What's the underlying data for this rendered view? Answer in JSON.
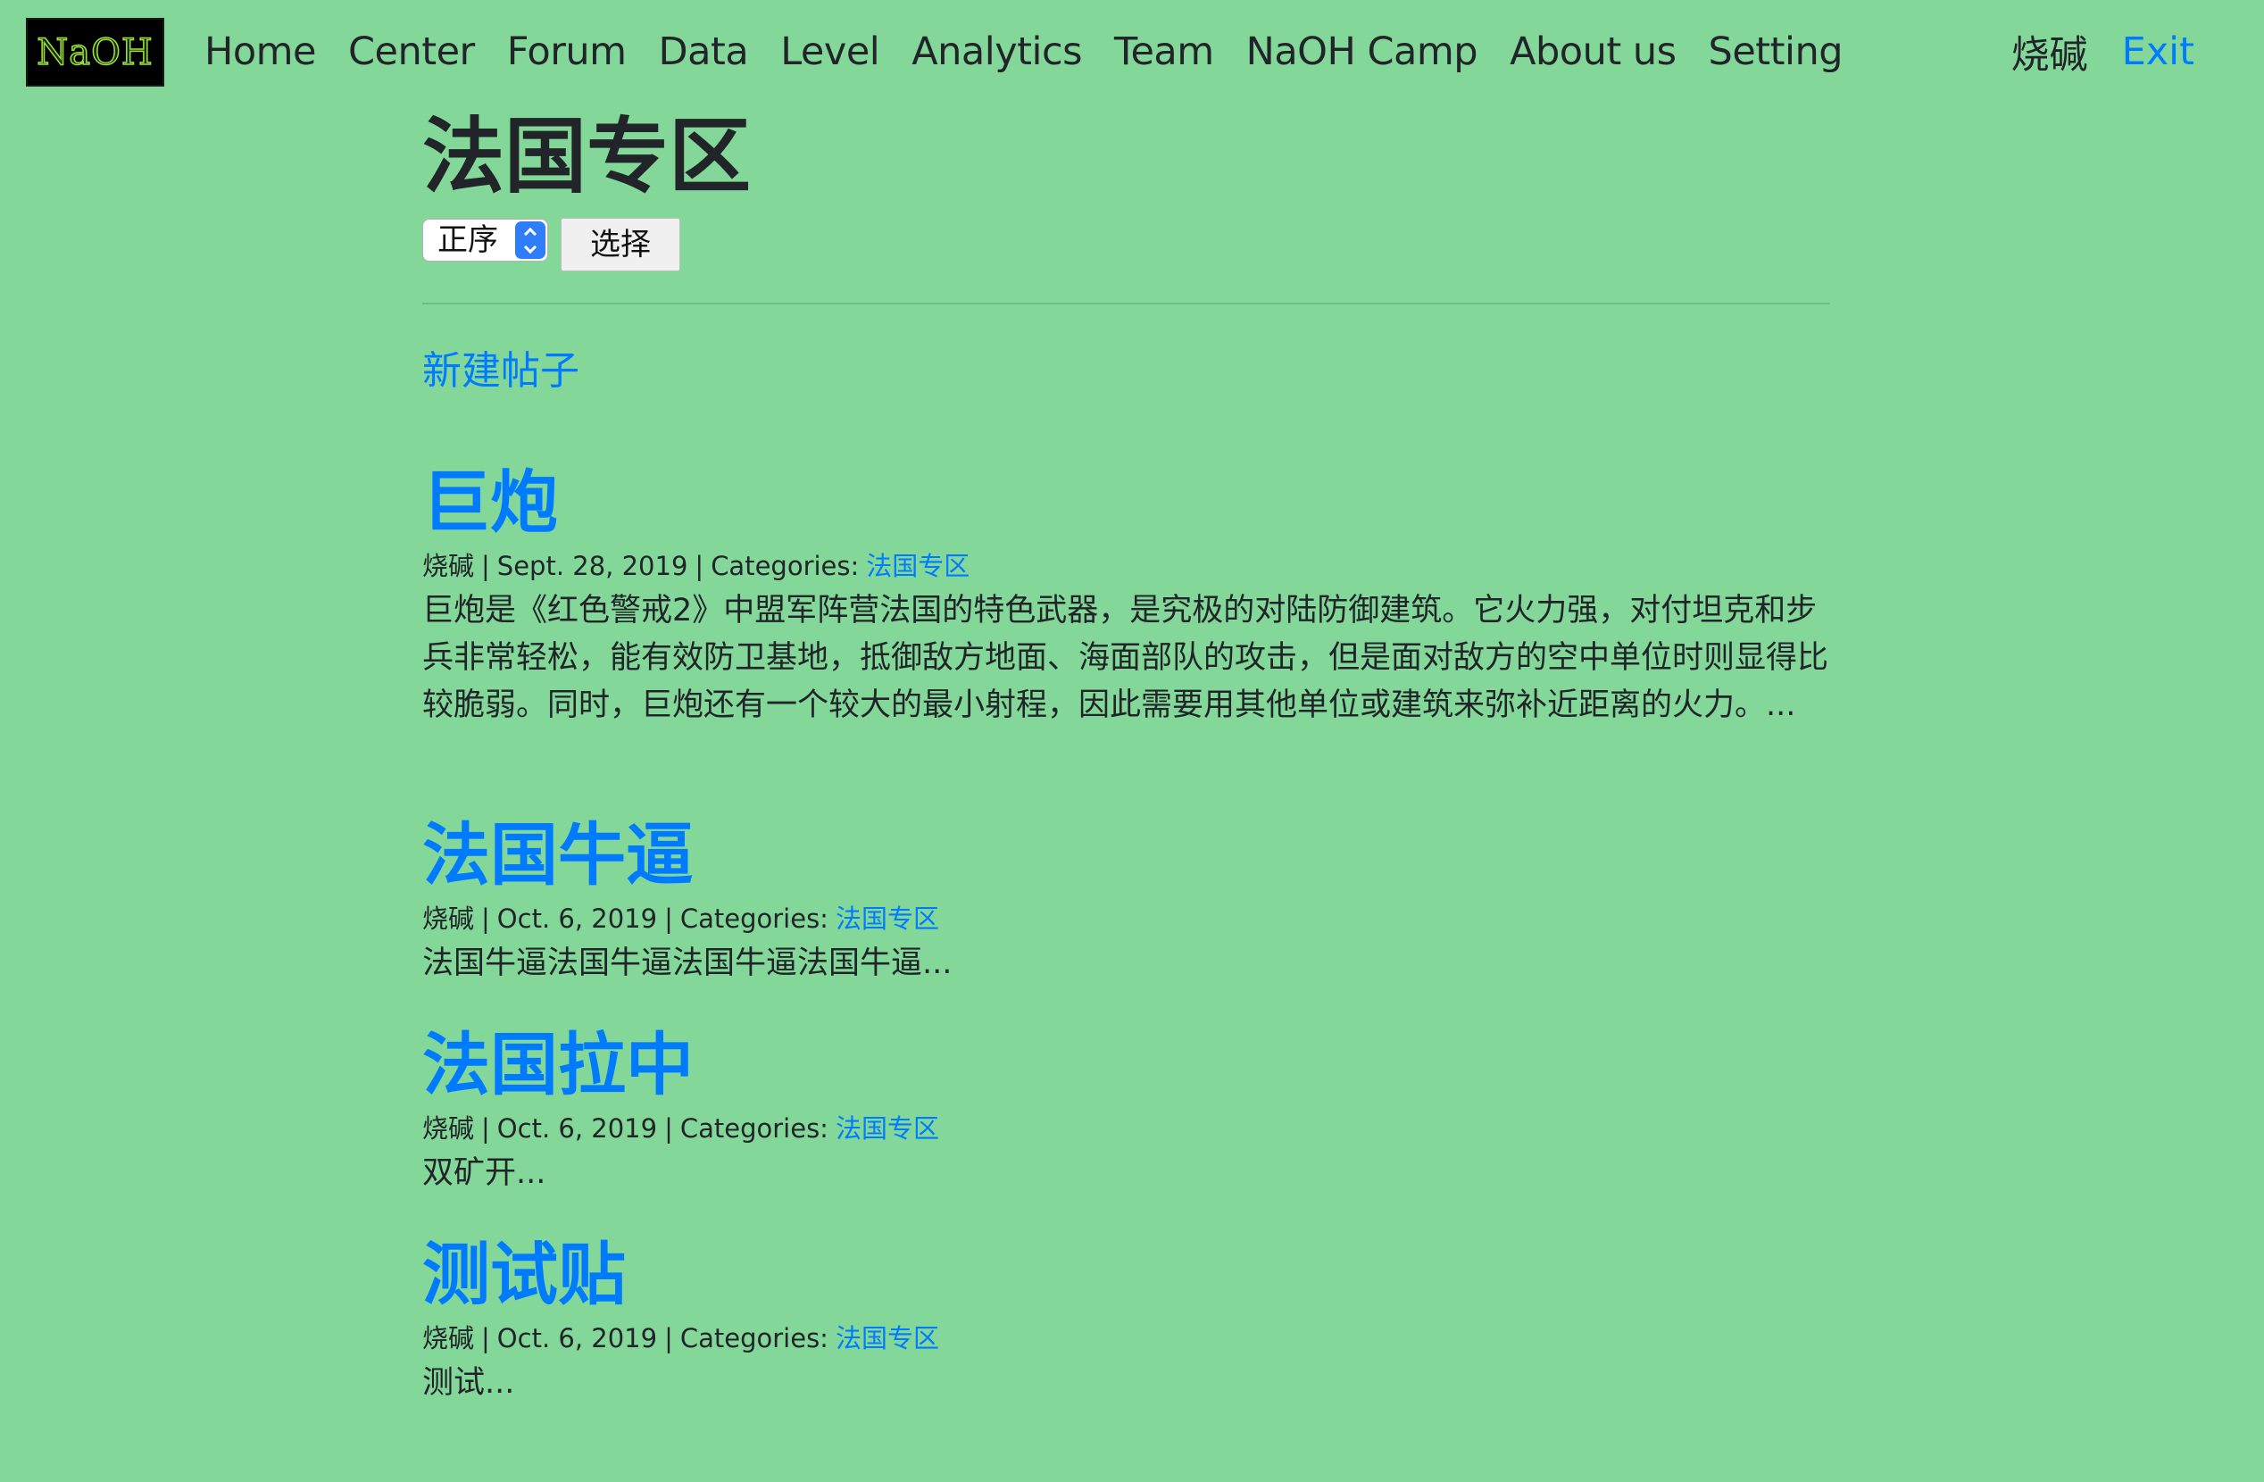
{
  "navbar": {
    "logo_text": "NaOH",
    "links": [
      "Home",
      "Center",
      "Forum",
      "Data",
      "Level",
      "Analytics",
      "Team",
      "NaOH Camp",
      "About us",
      "Setting"
    ],
    "username": "烧碱",
    "exit_label": "Exit"
  },
  "page": {
    "title": "法国专区",
    "sort_select_value": "正序",
    "sort_button_label": "选择",
    "new_post_label": "新建帖子"
  },
  "meta_labels": {
    "sep": "|",
    "categories": "Categories:"
  },
  "posts": [
    {
      "title": "巨炮",
      "author": "烧碱",
      "date": "Sept. 28, 2019",
      "category": "法国专区",
      "excerpt": "巨炮是《红色警戒2》中盟军阵营法国的特色武器，是究极的对陆防御建筑。它火力强，对付坦克和步兵非常轻松，能有效防卫基地，抵御敌方地面、海面部队的攻击，但是面对敌方的空中单位时则显得比较脆弱。同时，巨炮还有一个较大的最小射程，因此需要用其他单位或建筑来弥补近距离的火力。..."
    },
    {
      "title": "法国牛逼",
      "author": "烧碱",
      "date": "Oct. 6, 2019",
      "category": "法国专区",
      "excerpt": "法国牛逼法国牛逼法国牛逼法国牛逼..."
    },
    {
      "title": "法国拉中",
      "author": "烧碱",
      "date": "Oct. 6, 2019",
      "category": "法国专区",
      "excerpt": "双矿开..."
    },
    {
      "title": "测试贴",
      "author": "烧碱",
      "date": "Oct. 6, 2019",
      "category": "法国专区",
      "excerpt": "测试..."
    }
  ],
  "colors": {
    "background": "#83d799",
    "link": "#007bff",
    "text": "#212529"
  }
}
